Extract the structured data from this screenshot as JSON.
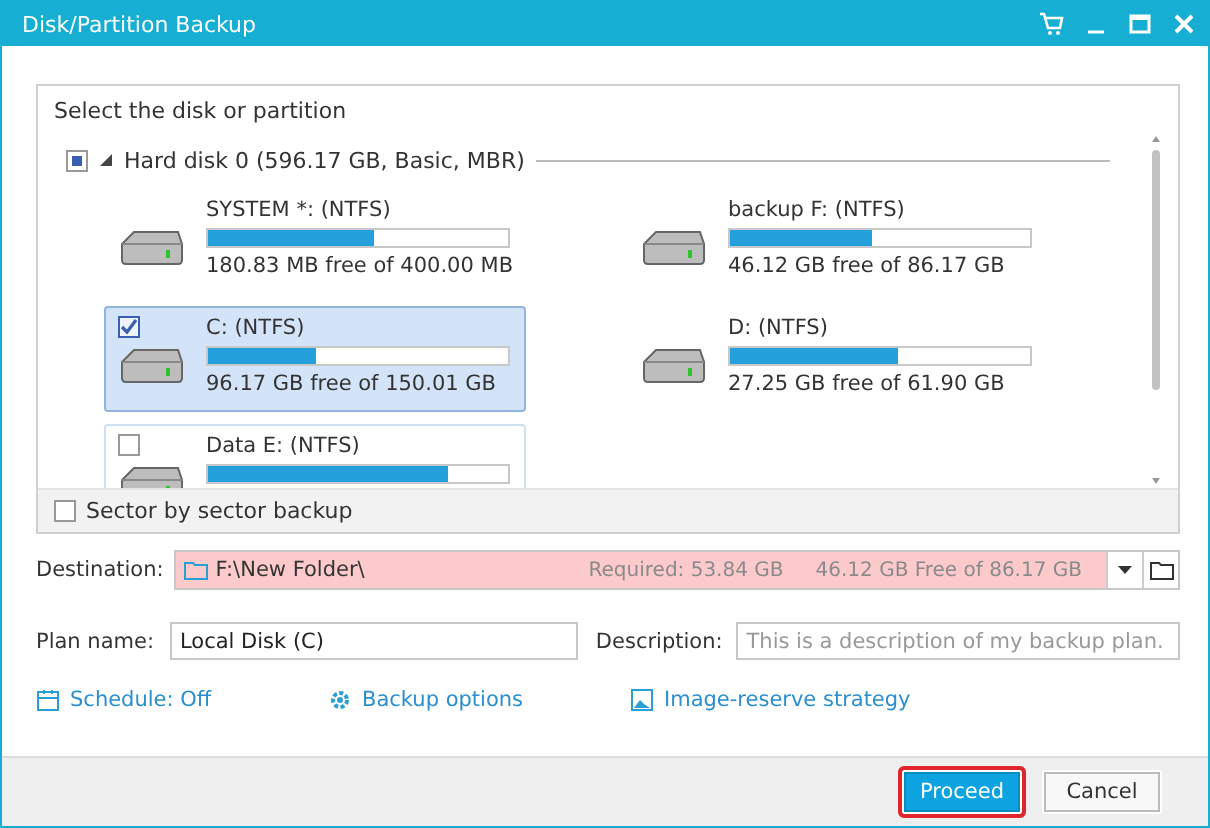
{
  "window": {
    "title": "Disk/Partition Backup"
  },
  "source": {
    "heading": "Select the disk or partition",
    "disk": {
      "label": "Hard disk 0 (596.17 GB, Basic, MBR)",
      "partial": true,
      "expanded": true
    },
    "partitions": [
      {
        "name": "SYSTEM *: (NTFS)",
        "level": 0.55,
        "reading": "180.83 MB free of 400.00 MB",
        "boxed": false,
        "selected": false
      },
      {
        "name": "backup F: (NTFS)",
        "level": 0.47,
        "reading": "46.12 GB free of 86.17 GB",
        "boxed": false,
        "selected": false
      },
      {
        "name": "C: (NTFS)",
        "level": 0.36,
        "reading": "96.17 GB free of 150.01 GB",
        "boxed": true,
        "selected": true,
        "checked": true
      },
      {
        "name": "D: (NTFS)",
        "level": 0.56,
        "reading": "27.25 GB free of 61.90 GB",
        "boxed": false,
        "selected": false
      },
      {
        "name": "Data E: (NTFS)",
        "level": 0.8,
        "boxed": true,
        "selected": false,
        "checked": false
      }
    ],
    "sector_backup": {
      "label": "Sector by sector backup",
      "checked": false
    }
  },
  "destination": {
    "label": "Destination:",
    "value": "F:\\New Folder\\",
    "required": "Required: 53.84 GB",
    "free": "46.12 GB Free of 86.17 GB",
    "error": true
  },
  "plan_name": {
    "label": "Plan name:",
    "value": "Local Disk (C)"
  },
  "description": {
    "label": "Description:",
    "placeholder": "This is a description of my backup plan."
  },
  "links": [
    {
      "kind": "calendar",
      "label": "Schedule: Off"
    },
    {
      "kind": "gear",
      "label": "Backup options"
    },
    {
      "kind": "image",
      "label": "Image-reserve strategy"
    }
  ],
  "buttons": [
    {
      "label": "Proceed",
      "primary": true,
      "focused": true
    },
    {
      "label": "Cancel",
      "primary": false,
      "focused": false
    }
  ]
}
